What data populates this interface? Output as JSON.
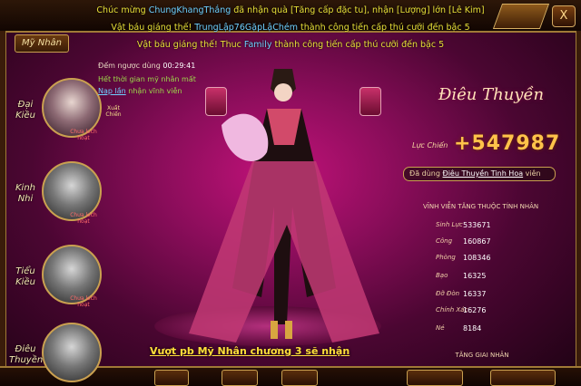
{
  "announcements": [
    {
      "prefix": "Chúc mừng",
      "player": "ChungKhangThắng",
      "suffix": "đã nhận quà [Tăng cấp đặc tu], nhận [Lượng] lớn [Lê Kim]"
    },
    {
      "prefix": "Vật báu giáng thế! ",
      "player": "TrungLập76GặpLậChém",
      "suffix": " thành công tiến cấp thú cưỡi đến bậc 5"
    },
    {
      "prefix": "Vật báu giáng thế! Thuc",
      "player": "Family",
      "suffix": " thành công tiến cấp thú cưỡi đến bậc 5"
    }
  ],
  "tab": {
    "label": "Mỹ Nhân"
  },
  "close": {
    "label": "X"
  },
  "heroes": [
    {
      "name": "Đại Kiều",
      "state": "Xuất Chiến",
      "lock": "Chưa kích hoạt",
      "color": "#e8c0c8"
    },
    {
      "name": "Kinh Nhi",
      "lock": "Chưa kích hoạt",
      "color": "#aaaaaa"
    },
    {
      "name": "Tiểu Kiều",
      "lock": "Chưa kích hoạt",
      "color": "#aaaaaa"
    },
    {
      "name": "Điêu Thuyền",
      "lock": "Chưa kích hoạt",
      "color": "#aaaaaa"
    }
  ],
  "timer": {
    "label": "Đếm ngược dùng",
    "value": "00:29:41"
  },
  "expired": "Hết thời gian mỹ nhân mất",
  "permanent": {
    "link": "Nạp lần",
    "rest": "nhận vĩnh viễn"
  },
  "banner": "Vượt pb Mỹ Nhân chương 3 sẽ nhận",
  "character": {
    "name": "Điêu Thuyền",
    "power_label": "Lực Chiến",
    "power_value": "+547987"
  },
  "used": {
    "prefix": "Đã dùng",
    "item": "Điêu Thuyền Tinh Hoa",
    "suffix": "viên"
  },
  "stats_title": "VĨNH VIỄN TĂNG THUỘC TÍNH NHÂN",
  "stats": [
    {
      "label": "Sinh Lực",
      "value": "533671"
    },
    {
      "label": "Công",
      "value": "160867"
    },
    {
      "label": "Phòng",
      "value": "108346"
    },
    {
      "label": "Bạo",
      "value": "16325"
    },
    {
      "label": "Đỡ Đòn",
      "value": "16337"
    },
    {
      "label": "Chính Xác",
      "value": "16276"
    },
    {
      "label": "Né",
      "value": "8184"
    }
  ],
  "grow_label": "TĂNG GIAI NHÂN"
}
